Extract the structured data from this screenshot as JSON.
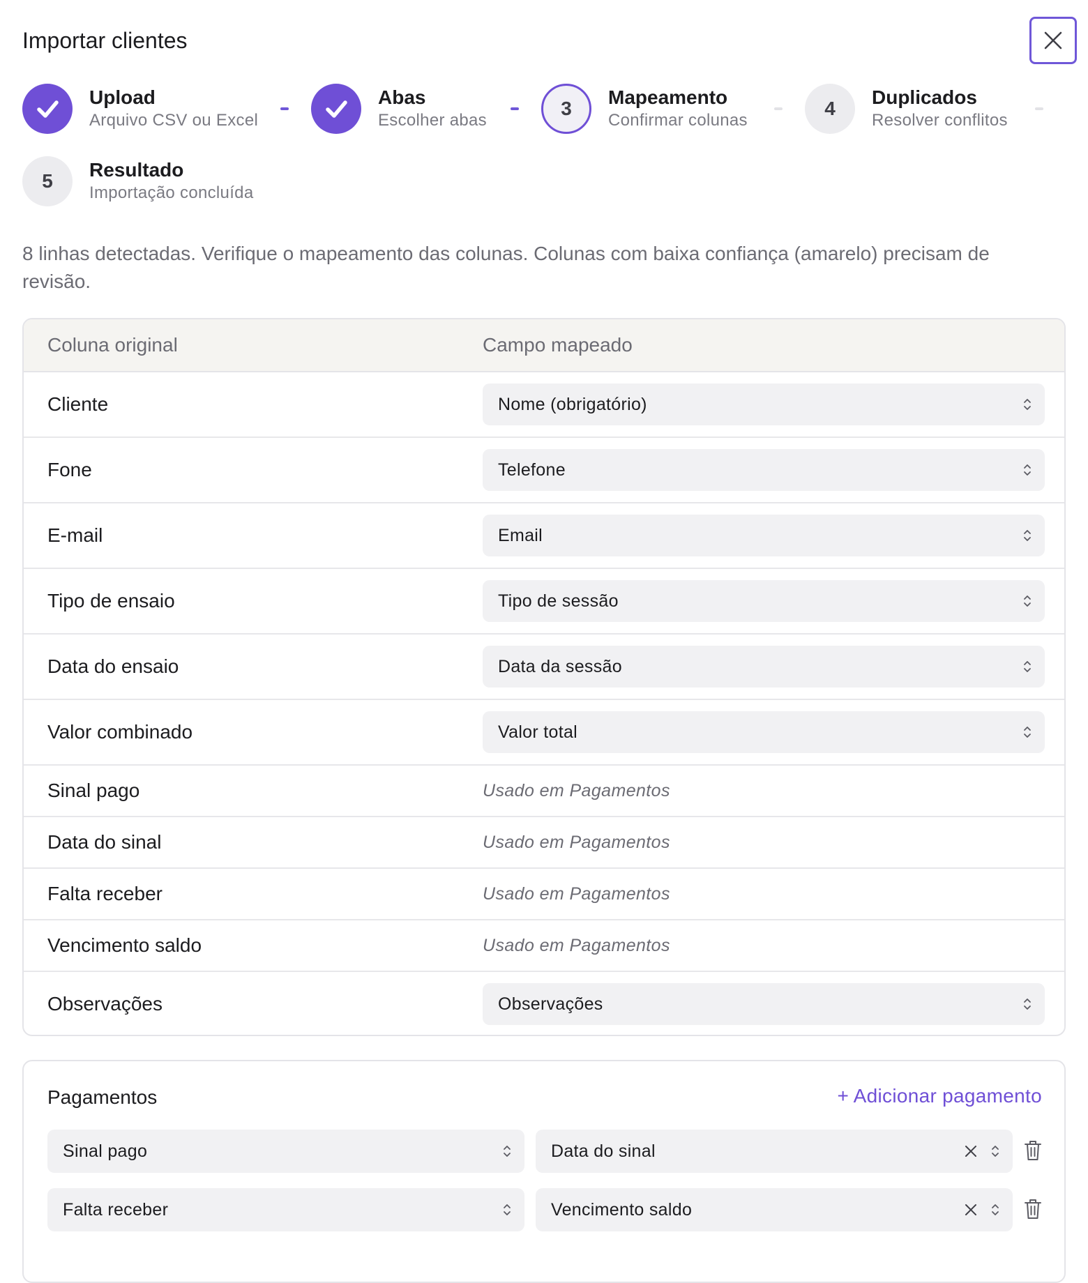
{
  "dialog": {
    "title": "Importar clientes",
    "accent_color": "#6f4fd6"
  },
  "steps": [
    {
      "number": "1",
      "title": "Upload",
      "subtitle": "Arquivo CSV ou Excel",
      "state": "done"
    },
    {
      "number": "2",
      "title": "Abas",
      "subtitle": "Escolher abas",
      "state": "done"
    },
    {
      "number": "3",
      "title": "Mapeamento",
      "subtitle": "Confirmar colunas",
      "state": "current"
    },
    {
      "number": "4",
      "title": "Duplicados",
      "subtitle": "Resolver conflitos",
      "state": "todo"
    },
    {
      "number": "5",
      "title": "Resultado",
      "subtitle": "Importação concluída",
      "state": "todo"
    }
  ],
  "description": "8 linhas detectadas. Verifique o mapeamento das colunas. Colunas com baixa confiança (amarelo) precisam de revisão.",
  "mapping": {
    "headers": {
      "original": "Coluna original",
      "mapped": "Campo mapeado"
    },
    "rows": [
      {
        "original": "Cliente",
        "mapped": "Nome (obrigatório)",
        "kind": "select"
      },
      {
        "original": "Fone",
        "mapped": "Telefone",
        "kind": "select"
      },
      {
        "original": "E-mail",
        "mapped": "Email",
        "kind": "select"
      },
      {
        "original": "Tipo de ensaio",
        "mapped": "Tipo de sessão",
        "kind": "select"
      },
      {
        "original": "Data do ensaio",
        "mapped": "Data da sessão",
        "kind": "select"
      },
      {
        "original": "Valor combinado",
        "mapped": "Valor total",
        "kind": "select"
      },
      {
        "original": "Sinal pago",
        "mapped": "Usado em Pagamentos",
        "kind": "note"
      },
      {
        "original": "Data do sinal",
        "mapped": "Usado em Pagamentos",
        "kind": "note"
      },
      {
        "original": "Falta receber",
        "mapped": "Usado em Pagamentos",
        "kind": "note"
      },
      {
        "original": "Vencimento saldo",
        "mapped": "Usado em Pagamentos",
        "kind": "note"
      },
      {
        "original": "Observações",
        "mapped": "Observações",
        "kind": "select"
      }
    ]
  },
  "payments": {
    "title": "Pagamentos",
    "add_label": "+ Adicionar pagamento",
    "rows": [
      {
        "amount_column": "Sinal pago",
        "date_column": "Data do sinal"
      },
      {
        "amount_column": "Falta receber",
        "date_column": "Vencimento saldo"
      }
    ]
  }
}
